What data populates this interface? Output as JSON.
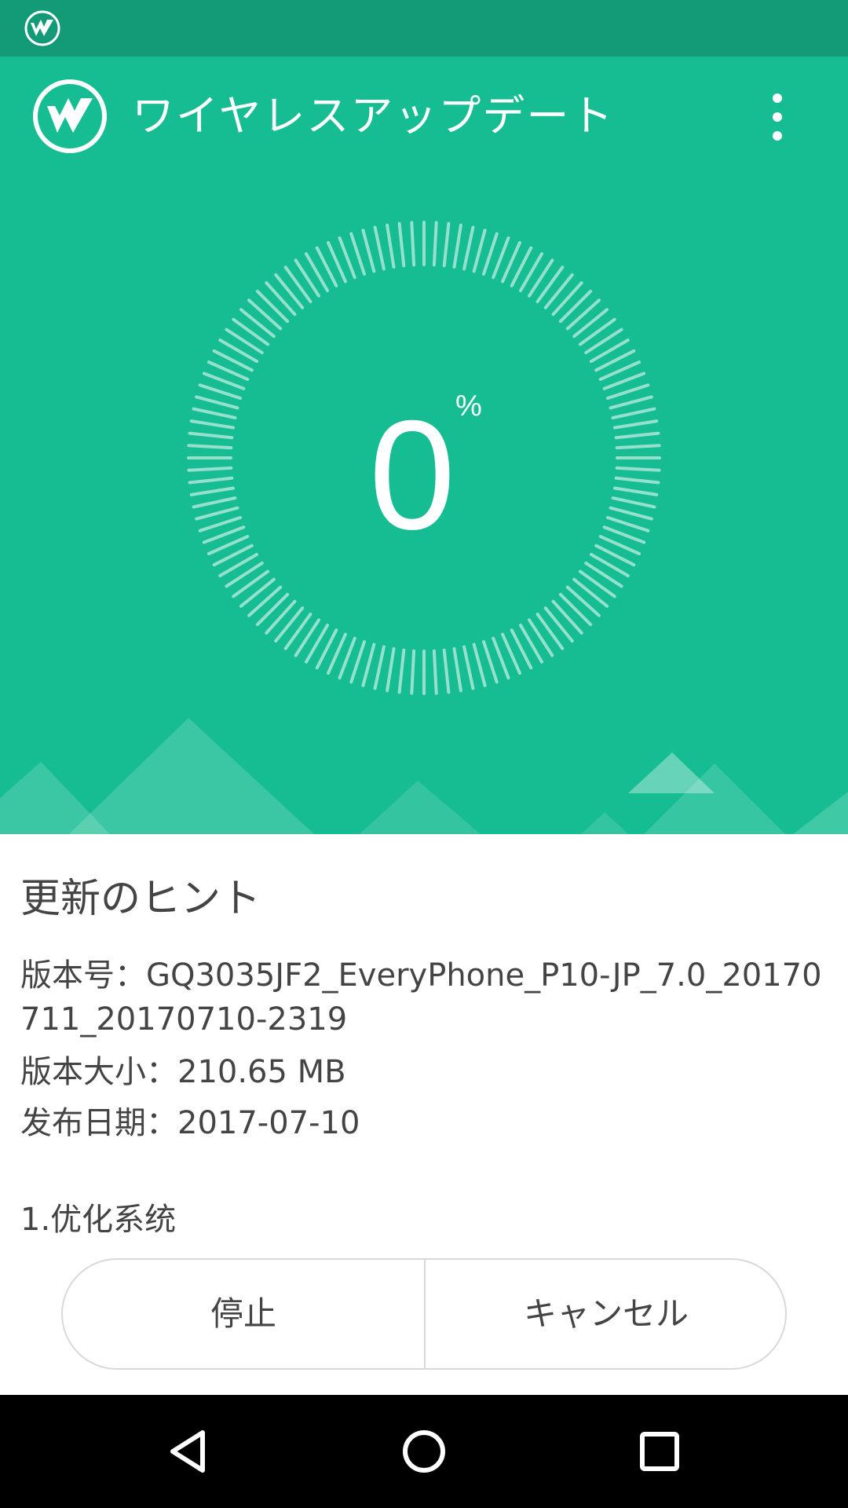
{
  "status_bar": {
    "app_icon": "wireless-update-notification-icon"
  },
  "app_bar": {
    "title": "ワイヤレスアップデート",
    "logo_icon": "wireless-update-logo-icon",
    "menu_icon": "more-vert-icon"
  },
  "progress": {
    "value": "0",
    "unit": "%",
    "fraction": 0.0
  },
  "update_info": {
    "heading": "更新のヒント",
    "version_line": "版本号：GQ3035JF2_EveryPhone_P10-JP_7.0_20170711_20170710-2319",
    "size_line": "版本大小：210.65 MB",
    "date_line": "发布日期：2017-07-10",
    "notes_line": "1.优化系统"
  },
  "actions": {
    "stop_label": "停止",
    "cancel_label": "キャンセル"
  },
  "nav_bar": {
    "back_icon": "back-triangle-icon",
    "home_icon": "home-circle-icon",
    "recents_icon": "recents-square-icon"
  },
  "colors": {
    "status_bar": "#139a76",
    "primary": "#16bd92",
    "text": "#444444",
    "divider": "#d9d9d9",
    "nav_bar": "#000000"
  }
}
